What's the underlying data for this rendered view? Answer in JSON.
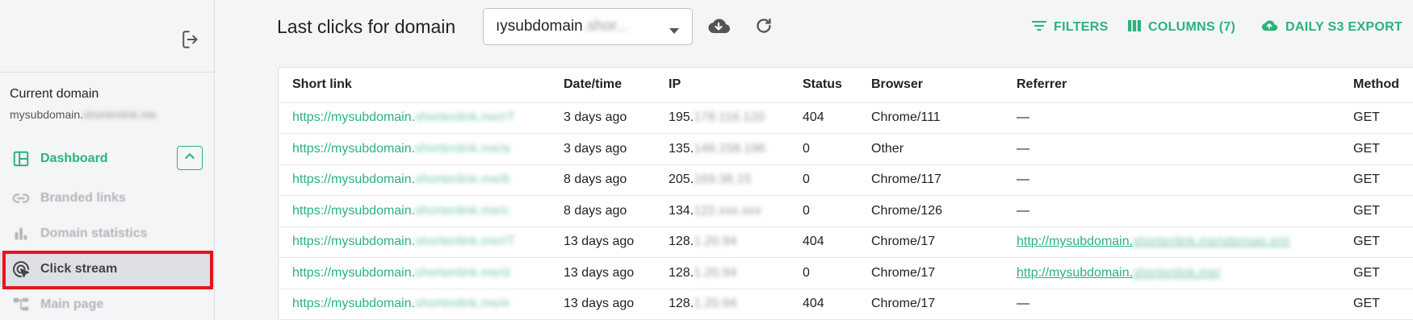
{
  "sidebar": {
    "current_domain_label": "Current domain",
    "current_domain_prefix": "mysubdomain.",
    "current_domain_blurred": "shortenlink.me",
    "nav": {
      "dashboard": "Dashboard",
      "branded_links": "Branded links",
      "domain_statistics": "Domain statistics",
      "click_stream": "Click stream",
      "main_page": "Main page"
    },
    "icons": {
      "logout": "logout-icon",
      "dashboard": "dashboard-icon",
      "collapse": "chevron-up-icon",
      "branded_links": "link-icon",
      "domain_statistics": "bar-chart-icon",
      "click_stream": "click-icon",
      "main_page": "sitemap-icon"
    },
    "accent_color": "#2bb37a",
    "highlight_color": "#e8141c"
  },
  "toolbar": {
    "title": "Last clicks for domain",
    "domain_select_value": "ıysubdomain",
    "domain_select_blurred": ".shor...",
    "filters_label": "FILTERS",
    "columns_label": "COLUMNS (7)",
    "export_label": "DAILY S3 EXPORT",
    "icons": {
      "download": "cloud-download-icon",
      "refresh": "refresh-icon",
      "filters": "filter-icon",
      "columns": "columns-icon",
      "export": "cloud-upload-icon",
      "dropdown": "caret-down-icon"
    }
  },
  "table": {
    "headers": {
      "short_link": "Short link",
      "datetime": "Date/time",
      "ip": "IP",
      "status": "Status",
      "browser": "Browser",
      "referrer": "Referrer",
      "method": "Method"
    },
    "rows": [
      {
        "link": "https://mysubdomain.",
        "link_blur": "shortenlink.me/rT",
        "date": "3 days ago",
        "ip": "195.",
        "ip_blur": "178.116.120",
        "status": "404",
        "browser": "Chrome/111",
        "referrer": "—",
        "referrer_blur": "",
        "method": "GET"
      },
      {
        "link": "https://mysubdomain.",
        "link_blur": "shortenlink.me/a",
        "date": "3 days ago",
        "ip": "135.",
        "ip_blur": "148.158.196",
        "status": "0",
        "browser": "Other",
        "referrer": "—",
        "referrer_blur": "",
        "method": "GET"
      },
      {
        "link": "https://mysubdomain.",
        "link_blur": "shortenlink.me/b",
        "date": "8 days ago",
        "ip": "205.",
        "ip_blur": "169.38.15",
        "status": "0",
        "browser": "Chrome/117",
        "referrer": "—",
        "referrer_blur": "",
        "method": "GET"
      },
      {
        "link": "https://mysubdomain.",
        "link_blur": "shortenlink.me/c",
        "date": "8 days ago",
        "ip": "134.",
        "ip_blur": "122.xxx.xxx",
        "status": "0",
        "browser": "Chrome/126",
        "referrer": "—",
        "referrer_blur": "",
        "method": "GET"
      },
      {
        "link": "https://mysubdomain.",
        "link_blur": "shortenlink.me/rT",
        "date": "13 days ago",
        "ip": "128.",
        "ip_blur": "1.20.94",
        "status": "404",
        "browser": "Chrome/17",
        "referrer": "http://mysubdomain.",
        "referrer_blur": "shortenlink.me/sitemap.xml",
        "method": "GET"
      },
      {
        "link": "https://mysubdomain.",
        "link_blur": "shortenlink.me/d",
        "date": "13 days ago",
        "ip": "128.",
        "ip_blur": "1.20.94",
        "status": "0",
        "browser": "Chrome/17",
        "referrer": "http://mysubdomain.",
        "referrer_blur": "shortenlink.me/",
        "method": "GET"
      },
      {
        "link": "https://mysubdomain.",
        "link_blur": "shortenlink.me/e",
        "date": "13 days ago",
        "ip": "128.",
        "ip_blur": "1.20.94",
        "status": "404",
        "browser": "Chrome/17",
        "referrer": "—",
        "referrer_blur": "",
        "method": "GET"
      }
    ]
  }
}
